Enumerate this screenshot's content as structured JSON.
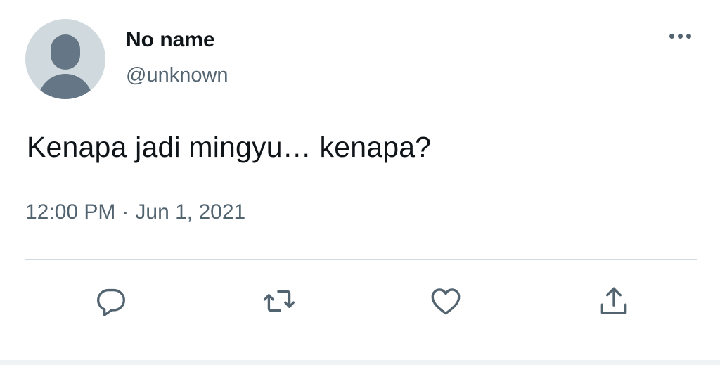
{
  "user": {
    "display_name": "No name",
    "handle": "@unknown",
    "avatar_icon": "default-avatar-icon"
  },
  "tweet": {
    "text": "Kenapa jadi mingyu… kenapa?",
    "time": "12:00 PM",
    "separator": "·",
    "date": "Jun 1, 2021"
  },
  "actions": {
    "more_icon": "more-dots-icon",
    "reply_icon": "reply-icon",
    "retweet_icon": "retweet-icon",
    "like_icon": "heart-icon",
    "share_icon": "share-icon"
  },
  "colors": {
    "text_primary": "#0f1419",
    "text_secondary": "#536471",
    "avatar_bg": "#cfd9de",
    "divider": "#cfd9de"
  }
}
